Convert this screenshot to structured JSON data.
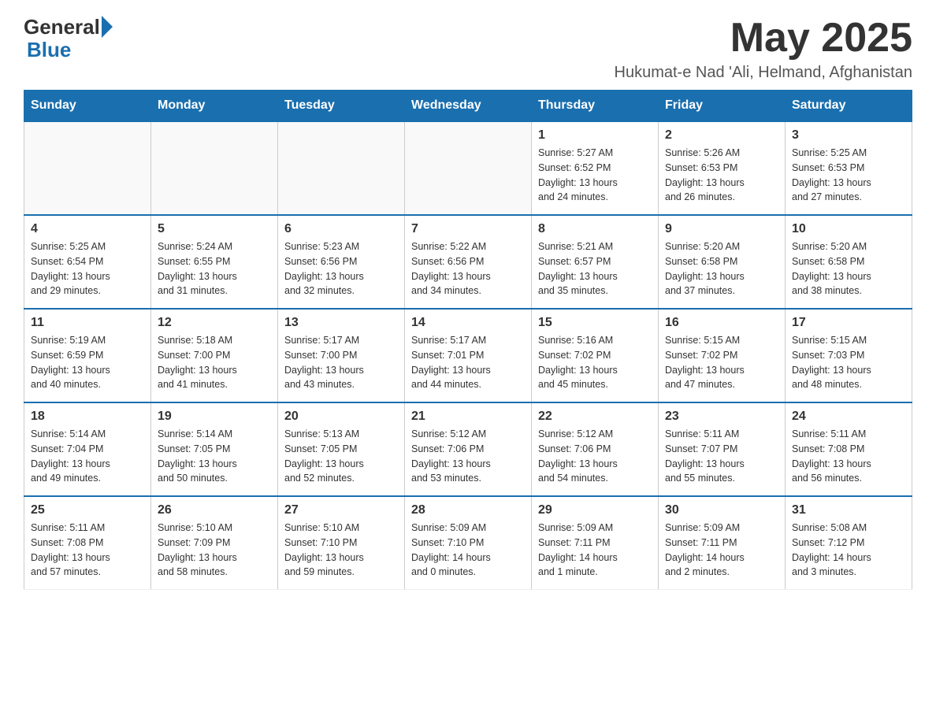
{
  "header": {
    "logo_general": "General",
    "logo_blue": "Blue",
    "month_title": "May 2025",
    "location": "Hukumat-e Nad 'Ali, Helmand, Afghanistan"
  },
  "days_of_week": [
    "Sunday",
    "Monday",
    "Tuesday",
    "Wednesday",
    "Thursday",
    "Friday",
    "Saturday"
  ],
  "weeks": [
    [
      {
        "day": "",
        "info": ""
      },
      {
        "day": "",
        "info": ""
      },
      {
        "day": "",
        "info": ""
      },
      {
        "day": "",
        "info": ""
      },
      {
        "day": "1",
        "info": "Sunrise: 5:27 AM\nSunset: 6:52 PM\nDaylight: 13 hours\nand 24 minutes."
      },
      {
        "day": "2",
        "info": "Sunrise: 5:26 AM\nSunset: 6:53 PM\nDaylight: 13 hours\nand 26 minutes."
      },
      {
        "day": "3",
        "info": "Sunrise: 5:25 AM\nSunset: 6:53 PM\nDaylight: 13 hours\nand 27 minutes."
      }
    ],
    [
      {
        "day": "4",
        "info": "Sunrise: 5:25 AM\nSunset: 6:54 PM\nDaylight: 13 hours\nand 29 minutes."
      },
      {
        "day": "5",
        "info": "Sunrise: 5:24 AM\nSunset: 6:55 PM\nDaylight: 13 hours\nand 31 minutes."
      },
      {
        "day": "6",
        "info": "Sunrise: 5:23 AM\nSunset: 6:56 PM\nDaylight: 13 hours\nand 32 minutes."
      },
      {
        "day": "7",
        "info": "Sunrise: 5:22 AM\nSunset: 6:56 PM\nDaylight: 13 hours\nand 34 minutes."
      },
      {
        "day": "8",
        "info": "Sunrise: 5:21 AM\nSunset: 6:57 PM\nDaylight: 13 hours\nand 35 minutes."
      },
      {
        "day": "9",
        "info": "Sunrise: 5:20 AM\nSunset: 6:58 PM\nDaylight: 13 hours\nand 37 minutes."
      },
      {
        "day": "10",
        "info": "Sunrise: 5:20 AM\nSunset: 6:58 PM\nDaylight: 13 hours\nand 38 minutes."
      }
    ],
    [
      {
        "day": "11",
        "info": "Sunrise: 5:19 AM\nSunset: 6:59 PM\nDaylight: 13 hours\nand 40 minutes."
      },
      {
        "day": "12",
        "info": "Sunrise: 5:18 AM\nSunset: 7:00 PM\nDaylight: 13 hours\nand 41 minutes."
      },
      {
        "day": "13",
        "info": "Sunrise: 5:17 AM\nSunset: 7:00 PM\nDaylight: 13 hours\nand 43 minutes."
      },
      {
        "day": "14",
        "info": "Sunrise: 5:17 AM\nSunset: 7:01 PM\nDaylight: 13 hours\nand 44 minutes."
      },
      {
        "day": "15",
        "info": "Sunrise: 5:16 AM\nSunset: 7:02 PM\nDaylight: 13 hours\nand 45 minutes."
      },
      {
        "day": "16",
        "info": "Sunrise: 5:15 AM\nSunset: 7:02 PM\nDaylight: 13 hours\nand 47 minutes."
      },
      {
        "day": "17",
        "info": "Sunrise: 5:15 AM\nSunset: 7:03 PM\nDaylight: 13 hours\nand 48 minutes."
      }
    ],
    [
      {
        "day": "18",
        "info": "Sunrise: 5:14 AM\nSunset: 7:04 PM\nDaylight: 13 hours\nand 49 minutes."
      },
      {
        "day": "19",
        "info": "Sunrise: 5:14 AM\nSunset: 7:05 PM\nDaylight: 13 hours\nand 50 minutes."
      },
      {
        "day": "20",
        "info": "Sunrise: 5:13 AM\nSunset: 7:05 PM\nDaylight: 13 hours\nand 52 minutes."
      },
      {
        "day": "21",
        "info": "Sunrise: 5:12 AM\nSunset: 7:06 PM\nDaylight: 13 hours\nand 53 minutes."
      },
      {
        "day": "22",
        "info": "Sunrise: 5:12 AM\nSunset: 7:06 PM\nDaylight: 13 hours\nand 54 minutes."
      },
      {
        "day": "23",
        "info": "Sunrise: 5:11 AM\nSunset: 7:07 PM\nDaylight: 13 hours\nand 55 minutes."
      },
      {
        "day": "24",
        "info": "Sunrise: 5:11 AM\nSunset: 7:08 PM\nDaylight: 13 hours\nand 56 minutes."
      }
    ],
    [
      {
        "day": "25",
        "info": "Sunrise: 5:11 AM\nSunset: 7:08 PM\nDaylight: 13 hours\nand 57 minutes."
      },
      {
        "day": "26",
        "info": "Sunrise: 5:10 AM\nSunset: 7:09 PM\nDaylight: 13 hours\nand 58 minutes."
      },
      {
        "day": "27",
        "info": "Sunrise: 5:10 AM\nSunset: 7:10 PM\nDaylight: 13 hours\nand 59 minutes."
      },
      {
        "day": "28",
        "info": "Sunrise: 5:09 AM\nSunset: 7:10 PM\nDaylight: 14 hours\nand 0 minutes."
      },
      {
        "day": "29",
        "info": "Sunrise: 5:09 AM\nSunset: 7:11 PM\nDaylight: 14 hours\nand 1 minute."
      },
      {
        "day": "30",
        "info": "Sunrise: 5:09 AM\nSunset: 7:11 PM\nDaylight: 14 hours\nand 2 minutes."
      },
      {
        "day": "31",
        "info": "Sunrise: 5:08 AM\nSunset: 7:12 PM\nDaylight: 14 hours\nand 3 minutes."
      }
    ]
  ]
}
